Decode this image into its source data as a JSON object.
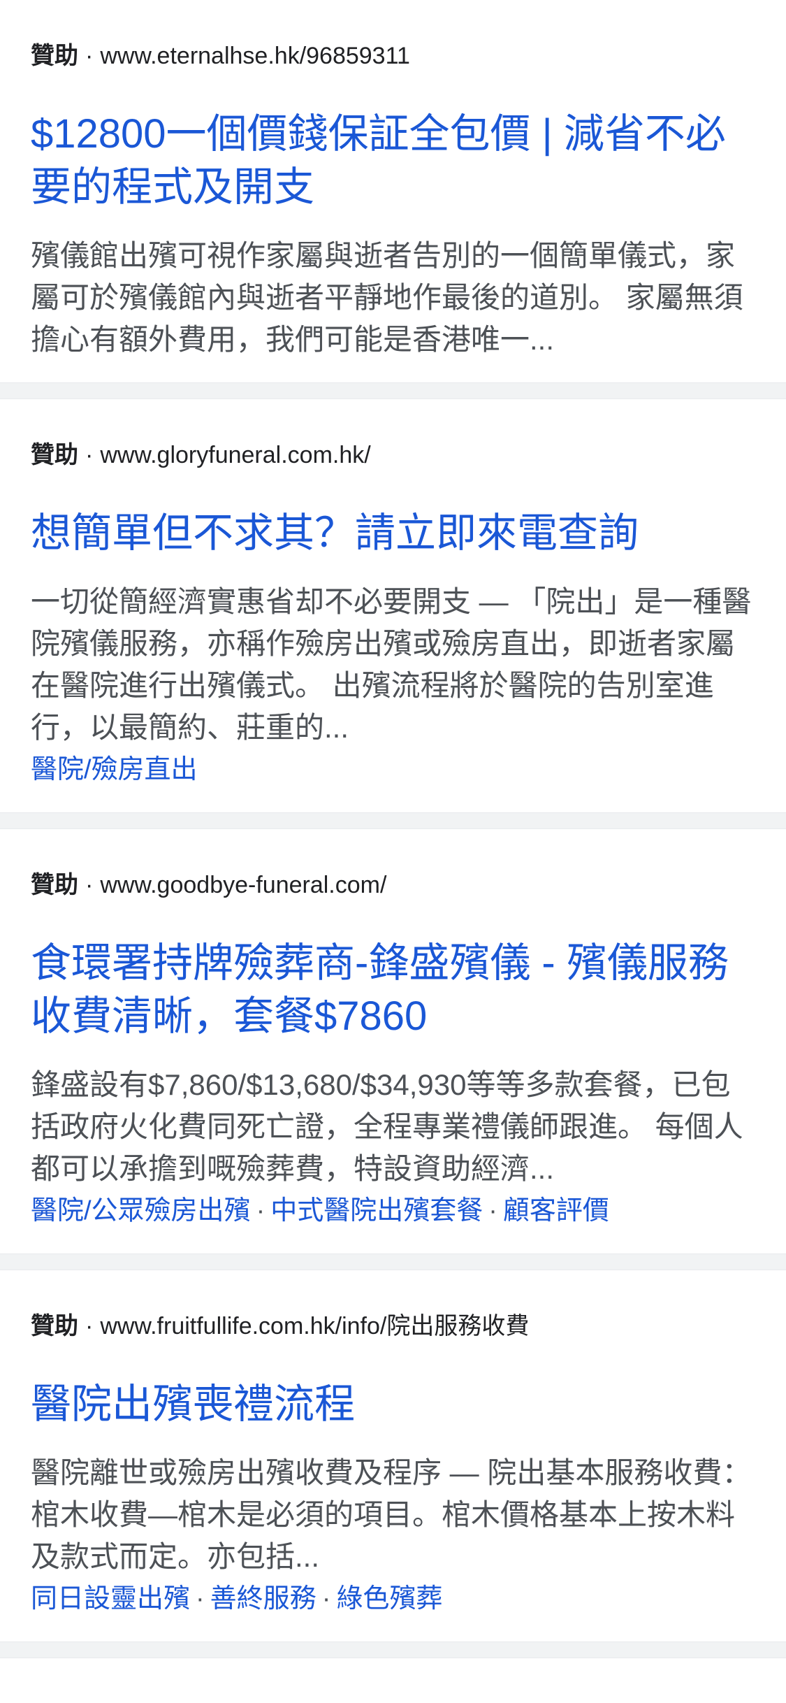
{
  "ads": [
    {
      "sponsored": "贊助",
      "separator": "·",
      "url": "www.eternalhse.hk/96859311",
      "title": "$12800一個價錢保証全包價 | 減省不必要的程式及開支",
      "snippet": "殯儀館出殯可視作家屬與逝者告別的一個簡單儀式，家屬可於殯儀館內與逝者平靜地作最後的道別。 家屬無須擔心有額外費用，我們可能是香港唯一...",
      "sitelinks": []
    },
    {
      "sponsored": "贊助",
      "separator": "·",
      "url": "www.gloryfuneral.com.hk/",
      "title": "想簡單但不求其？請立即來電查詢",
      "snippet": "一切從簡經濟實惠省却不必要開支 — 「院出」是一種醫院殯儀服務，亦稱作殮房出殯或殮房直出，即逝者家屬在醫院進行出殯儀式。 出殯流程將於醫院的告別室進行，以最簡約、莊重的...",
      "sitelinks": [
        "醫院/殮房直出"
      ]
    },
    {
      "sponsored": "贊助",
      "separator": "·",
      "url": "www.goodbye-funeral.com/",
      "title": "食環署持牌殮葬商-鋒盛殯儀 - 殯儀服務收費清晰，套餐$7860",
      "snippet": "鋒盛設有$7,860/$13,680/$34,930等等多款套餐，已包括政府火化費同死亡證，全程專業禮儀師跟進。 每個人都可以承擔到嘅殮葬費，特設資助經濟...",
      "sitelinks": [
        "醫院/公眾殮房出殯",
        "中式醫院出殯套餐",
        "顧客評價"
      ]
    },
    {
      "sponsored": "贊助",
      "separator": "·",
      "url": "www.fruitfullife.com.hk/info/院出服務收費",
      "title": "醫院出殯喪禮流程",
      "snippet": "醫院離世或殮房出殯收費及程序 — 院出基本服務收費：棺木收費—棺木是必須的項目。棺木價格基本上按木料及款式而定。亦包括...",
      "sitelinks": [
        "同日設靈出殯",
        "善終服務",
        "綠色殯葬"
      ]
    }
  ],
  "link_separator": "·"
}
